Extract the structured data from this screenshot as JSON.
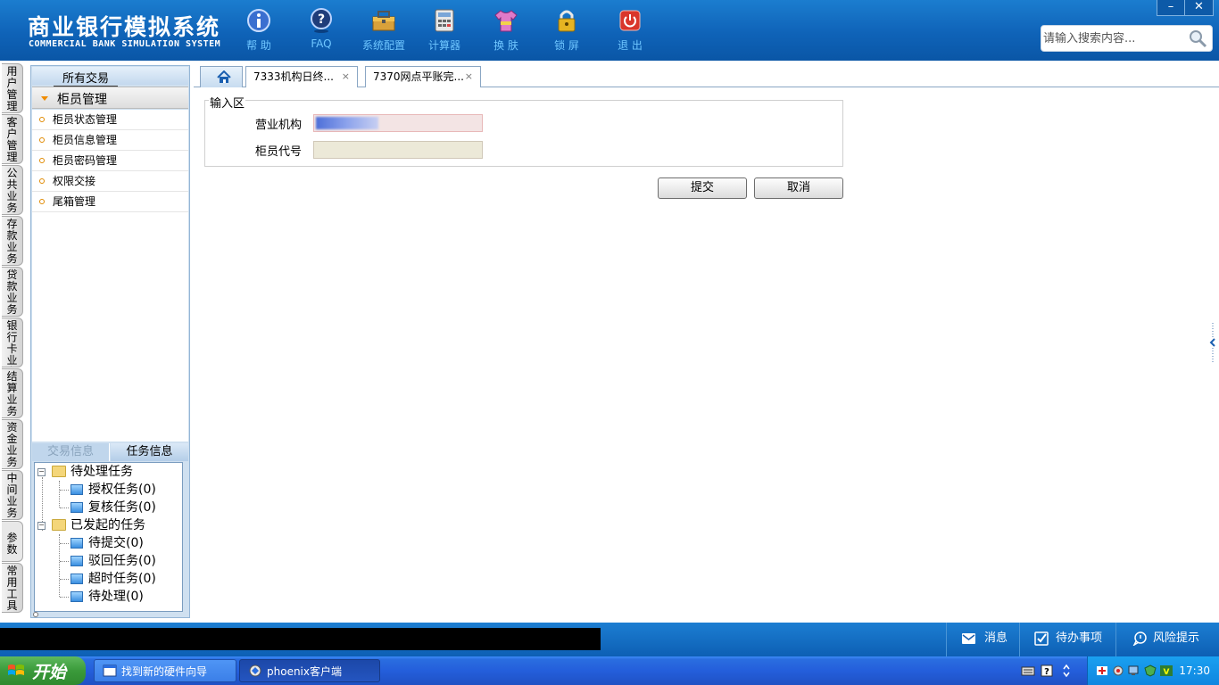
{
  "header": {
    "title": "商业银行模拟系统",
    "subtitle": "COMMERCIAL BANK SIMULATION SYSTEM",
    "toolbar": [
      {
        "label": "帮 助",
        "icon": "help-icon"
      },
      {
        "label": "FAQ",
        "icon": "faq-icon"
      },
      {
        "label": "系统配置",
        "icon": "toolbox-icon"
      },
      {
        "label": "计算器",
        "icon": "calculator-icon"
      },
      {
        "label": "换 肤",
        "icon": "tshirt-icon"
      },
      {
        "label": "锁 屏",
        "icon": "lock-icon"
      },
      {
        "label": "退 出",
        "icon": "power-icon"
      }
    ],
    "window_controls": {
      "minimize": "–",
      "close": "✕"
    },
    "search": {
      "placeholder": "请输入搜索内容..."
    }
  },
  "vertical_nav": [
    "用户管理",
    "客户管理",
    "公共业务",
    "存款业务",
    "贷款业务",
    "银行卡业务",
    "结算业务",
    "资金业务",
    "中间业务",
    "参数",
    "常用工具"
  ],
  "left_panel": {
    "header": "所有交易",
    "group": "柜员管理",
    "items": [
      "柜员状态管理",
      "柜员信息管理",
      "柜员密码管理",
      "权限交接",
      "尾箱管理"
    ],
    "tabs": {
      "trade": "交易信息",
      "task": "任务信息"
    },
    "tree": {
      "pending": {
        "label": "待处理任务",
        "children": [
          "授权任务(0)",
          "复核任务(0)"
        ]
      },
      "initiated": {
        "label": "已发起的任务",
        "children": [
          "待提交(0)",
          "驳回任务(0)",
          "超时任务(0)",
          "待处理(0)"
        ]
      }
    }
  },
  "tabs": [
    {
      "label": "7333机构日终...",
      "close": "×"
    },
    {
      "label": "7370网点平账完...",
      "close": "×"
    }
  ],
  "form": {
    "legend": "输入区",
    "fields": [
      {
        "label": "营业机构",
        "value": ""
      },
      {
        "label": "柜员代号",
        "value": ""
      }
    ],
    "submit": "提交",
    "cancel": "取消"
  },
  "statusbar": {
    "messages": "消息",
    "todo": "待办事项",
    "risk": "风险提示"
  },
  "taskbar": {
    "start": "开始",
    "tasks": [
      "找到新的硬件向导",
      "phoenix客户端"
    ],
    "time": "17:30"
  },
  "colors": {
    "header_blue": "#0f63b8",
    "toolbar_label": "#6fc6ff",
    "taskbar_blue": "#245edb",
    "start_green": "#3a9a3a"
  }
}
